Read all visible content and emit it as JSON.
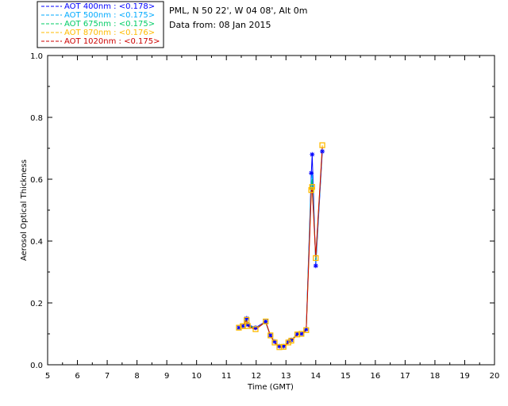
{
  "chart_data": {
    "type": "line",
    "title_lines": [
      "PML, N 50 22', W 04 08', Alt 0m",
      "Data from: 08 Jan 2015"
    ],
    "xlabel": "Time (GMT)",
    "ylabel": "Aerosol Optical Thickness",
    "xlim": [
      5,
      20
    ],
    "ylim": [
      0,
      1.0
    ],
    "xticks": [
      "5",
      "6",
      "7",
      "8",
      "9",
      "10",
      "11",
      "12",
      "13",
      "14",
      "15",
      "16",
      "17",
      "18",
      "19",
      "20"
    ],
    "xtick_values": [
      5,
      6,
      7,
      8,
      9,
      10,
      11,
      12,
      13,
      14,
      15,
      16,
      17,
      18,
      19,
      20
    ],
    "yticks": [
      "0.0",
      "0.2",
      "0.4",
      "0.6",
      "0.8",
      "1.0"
    ],
    "ytick_values": [
      0,
      0.2,
      0.4,
      0.6,
      0.8,
      1.0
    ],
    "grid": false,
    "legend_position": "top-left",
    "x": [
      11.42,
      11.55,
      11.68,
      11.72,
      11.98,
      12.32,
      12.48,
      12.62,
      12.78,
      12.92,
      13.08,
      13.18,
      13.38,
      13.52,
      13.68,
      13.85,
      13.88,
      14.0,
      14.22
    ],
    "series": [
      {
        "name": "AOT  400nm : <0.178>",
        "color": "#0000ff",
        "marker": "star",
        "values": [
          0.12,
          0.125,
          0.15,
          0.13,
          0.12,
          0.14,
          0.095,
          0.075,
          0.06,
          0.06,
          0.075,
          0.08,
          0.1,
          0.1,
          0.115,
          0.62,
          0.68,
          0.32,
          0.69
        ]
      },
      {
        "name": "AOT  500nm : <0.175>",
        "color": "#00aaff",
        "marker": "none",
        "values": [
          0.12,
          0.125,
          0.148,
          0.128,
          0.118,
          0.138,
          0.094,
          0.074,
          0.059,
          0.06,
          0.074,
          0.079,
          0.1,
          0.1,
          0.114,
          0.6,
          0.62,
          0.33,
          0.7
        ]
      },
      {
        "name": "AOT  675nm : <0.175>",
        "color": "#00cc66",
        "marker": "none",
        "values": [
          0.12,
          0.125,
          0.147,
          0.127,
          0.117,
          0.137,
          0.094,
          0.073,
          0.058,
          0.059,
          0.073,
          0.078,
          0.099,
          0.1,
          0.113,
          0.58,
          0.6,
          0.34,
          0.705
        ]
      },
      {
        "name": "AOT  870nm : <0.176>",
        "color": "#ffbb00",
        "marker": "square",
        "values": [
          0.12,
          0.125,
          0.145,
          0.125,
          0.115,
          0.14,
          0.095,
          0.072,
          0.057,
          0.058,
          0.072,
          0.078,
          0.098,
          0.1,
          0.112,
          0.565,
          0.575,
          0.345,
          0.71
        ]
      },
      {
        "name": "AOT 1020nm : <0.175>",
        "color": "#cc0000",
        "marker": "none",
        "values": [
          0.12,
          0.125,
          0.144,
          0.124,
          0.114,
          0.139,
          0.094,
          0.071,
          0.056,
          0.057,
          0.071,
          0.077,
          0.097,
          0.1,
          0.111,
          0.56,
          0.57,
          0.35,
          0.705
        ]
      }
    ]
  }
}
